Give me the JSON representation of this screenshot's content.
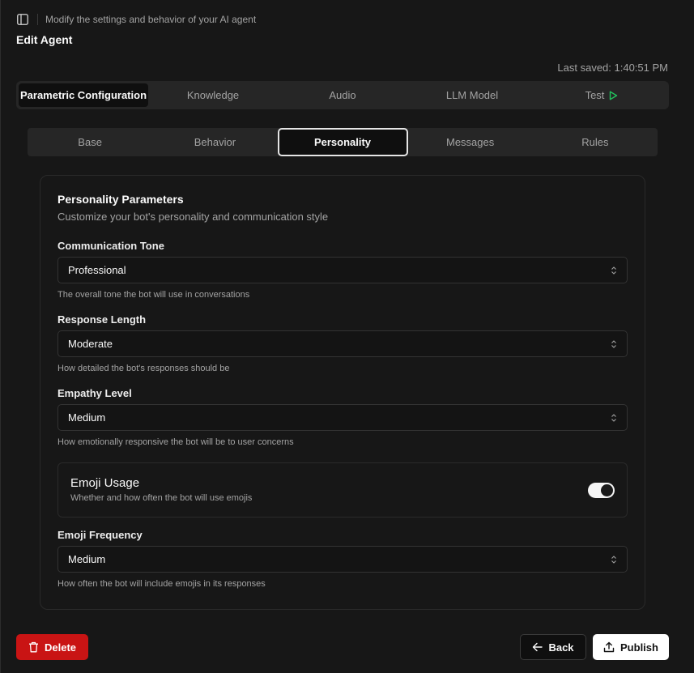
{
  "header": {
    "subtitle": "Modify the settings and behavior of your AI agent",
    "title": "Edit Agent",
    "last_saved": "Last saved: 1:40:51 PM"
  },
  "main_tabs": [
    {
      "label": "Parametric Configuration",
      "active": true
    },
    {
      "label": "Knowledge"
    },
    {
      "label": "Audio"
    },
    {
      "label": "LLM Model"
    },
    {
      "label": "Test",
      "icon": "play-icon",
      "icon_color": "#22c55e"
    }
  ],
  "sub_tabs": [
    {
      "label": "Base"
    },
    {
      "label": "Behavior"
    },
    {
      "label": "Personality",
      "active": true
    },
    {
      "label": "Messages"
    },
    {
      "label": "Rules"
    }
  ],
  "card": {
    "title": "Personality Parameters",
    "description": "Customize your bot's personality and communication style",
    "fields": [
      {
        "label": "Communication Tone",
        "value": "Professional",
        "hint": "The overall tone the bot will use in conversations"
      },
      {
        "label": "Response Length",
        "value": "Moderate",
        "hint": "How detailed the bot's responses should be"
      },
      {
        "label": "Empathy Level",
        "value": "Medium",
        "hint": "How emotionally responsive the bot will be to user concerns"
      }
    ],
    "emoji_toggle": {
      "title": "Emoji Usage",
      "description": "Whether and how often the bot will use emojis",
      "enabled": true
    },
    "emoji_frequency": {
      "label": "Emoji Frequency",
      "value": "Medium",
      "hint": "How often the bot will include emojis in its responses"
    }
  },
  "footer": {
    "delete_label": "Delete",
    "back_label": "Back",
    "publish_label": "Publish"
  },
  "colors": {
    "delete": "#c91414",
    "test_play": "#22c55e"
  }
}
